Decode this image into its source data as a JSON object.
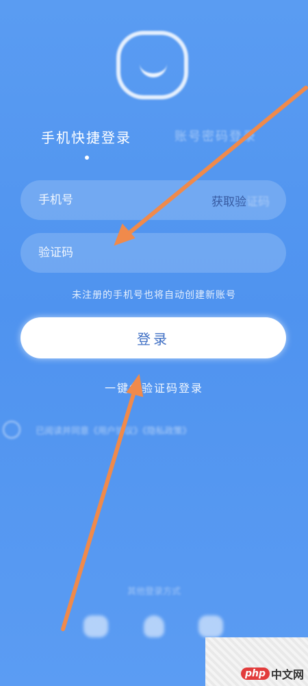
{
  "tabs": {
    "active": "手机快捷登录",
    "inactive": "账号密码登录"
  },
  "phone_field": {
    "placeholder": "手机号",
    "get_code": "获取验",
    "get_code_tail": "证码"
  },
  "code_field": {
    "placeholder": "验证码"
  },
  "notice": "未注册的手机号也将自动创建新账号",
  "login_button": "登录",
  "onekey_login": "一键免验证码登录",
  "agreement": "已阅读并同意《用户协议》《隐私政策》",
  "other_login": "其他登录方式",
  "social_icons": [
    "wechat-icon",
    "qq-icon",
    "weibo-icon"
  ],
  "colors": {
    "background": "#5a9cf2",
    "button_text": "#3f6fc4",
    "arrow": "#f08a4b"
  },
  "watermark": {
    "badge": "php",
    "text": "中文网"
  }
}
